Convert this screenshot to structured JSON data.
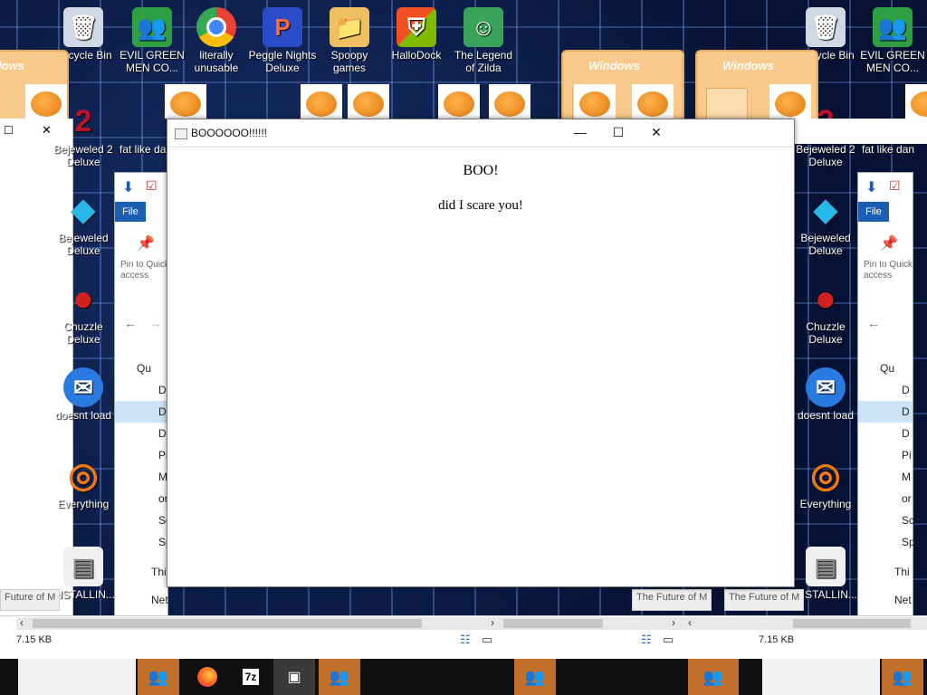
{
  "desktop_icons_left": [
    {
      "name": "recycle-bin-icon",
      "label": "Recycle Bin",
      "glyph": "🗑",
      "color": "#cfd8e3"
    },
    {
      "name": "evil-green-men-icon",
      "label": "EVIL GREEN MEN CO...",
      "glyph": "👥",
      "color": "#2ea043"
    },
    {
      "name": "chrome-icon",
      "label": "literally unusable",
      "glyph": "◉",
      "color": "#e94235"
    },
    {
      "name": "peggle-icon",
      "label": "Peggle Nights Deluxe",
      "glyph": "P",
      "color": "#d93a3a"
    },
    {
      "name": "spoopy-games-icon",
      "label": "Spoopy games",
      "glyph": "📁",
      "color": "#f0c060"
    },
    {
      "name": "hallodock-icon",
      "label": "HalloDock",
      "glyph": "⛨",
      "color": "#2f7de1"
    },
    {
      "name": "zelda-icon",
      "label": "The Legend of Zilda",
      "glyph": "☺",
      "color": "#3aa35c"
    }
  ],
  "desktop_icons_col": [
    {
      "name": "bejeweled2-icon",
      "label": "Bejeweled 2 Deluxe",
      "glyph": "2",
      "color": "#c01030"
    },
    {
      "name": "bejeweled-icon",
      "label": "Bejeweled Deluxe",
      "glyph": "◆",
      "color": "#28b8e8"
    },
    {
      "name": "chuzzle-icon",
      "label": "Chuzzle Deluxe",
      "glyph": "●",
      "color": "#d02020"
    },
    {
      "name": "doesnt-load-icon",
      "label": "doesnt load",
      "glyph": "✉",
      "color": "#2a7be0"
    },
    {
      "name": "everything-icon",
      "label": "Everything",
      "glyph": "◎",
      "color": "#f07a10"
    },
    {
      "name": "installing-icon",
      "label": "INSTALLIN...",
      "glyph": "▤",
      "color": "#e8e8e8"
    }
  ],
  "extra_label": "fat like dan",
  "popup": {
    "title": "BOOOOOO!!!!!!",
    "heading": "BOO!",
    "text": "did I scare you!"
  },
  "explorer": {
    "file_tab": "File",
    "pin_label": "Pin to Quick access",
    "nav_items": [
      "Qu",
      "D",
      "D",
      "D",
      "Pi",
      "M",
      "or",
      "Sc",
      "Sp",
      "Thi",
      "Net"
    ],
    "status": "7.15 KB",
    "future_tab": "Future of M",
    "the_future": "The Future of M"
  },
  "winxp_caption": "Windows",
  "taskbar_items": [
    "evil-green-men",
    "firefox",
    "7zip",
    "explorer",
    "evil-green-men"
  ]
}
